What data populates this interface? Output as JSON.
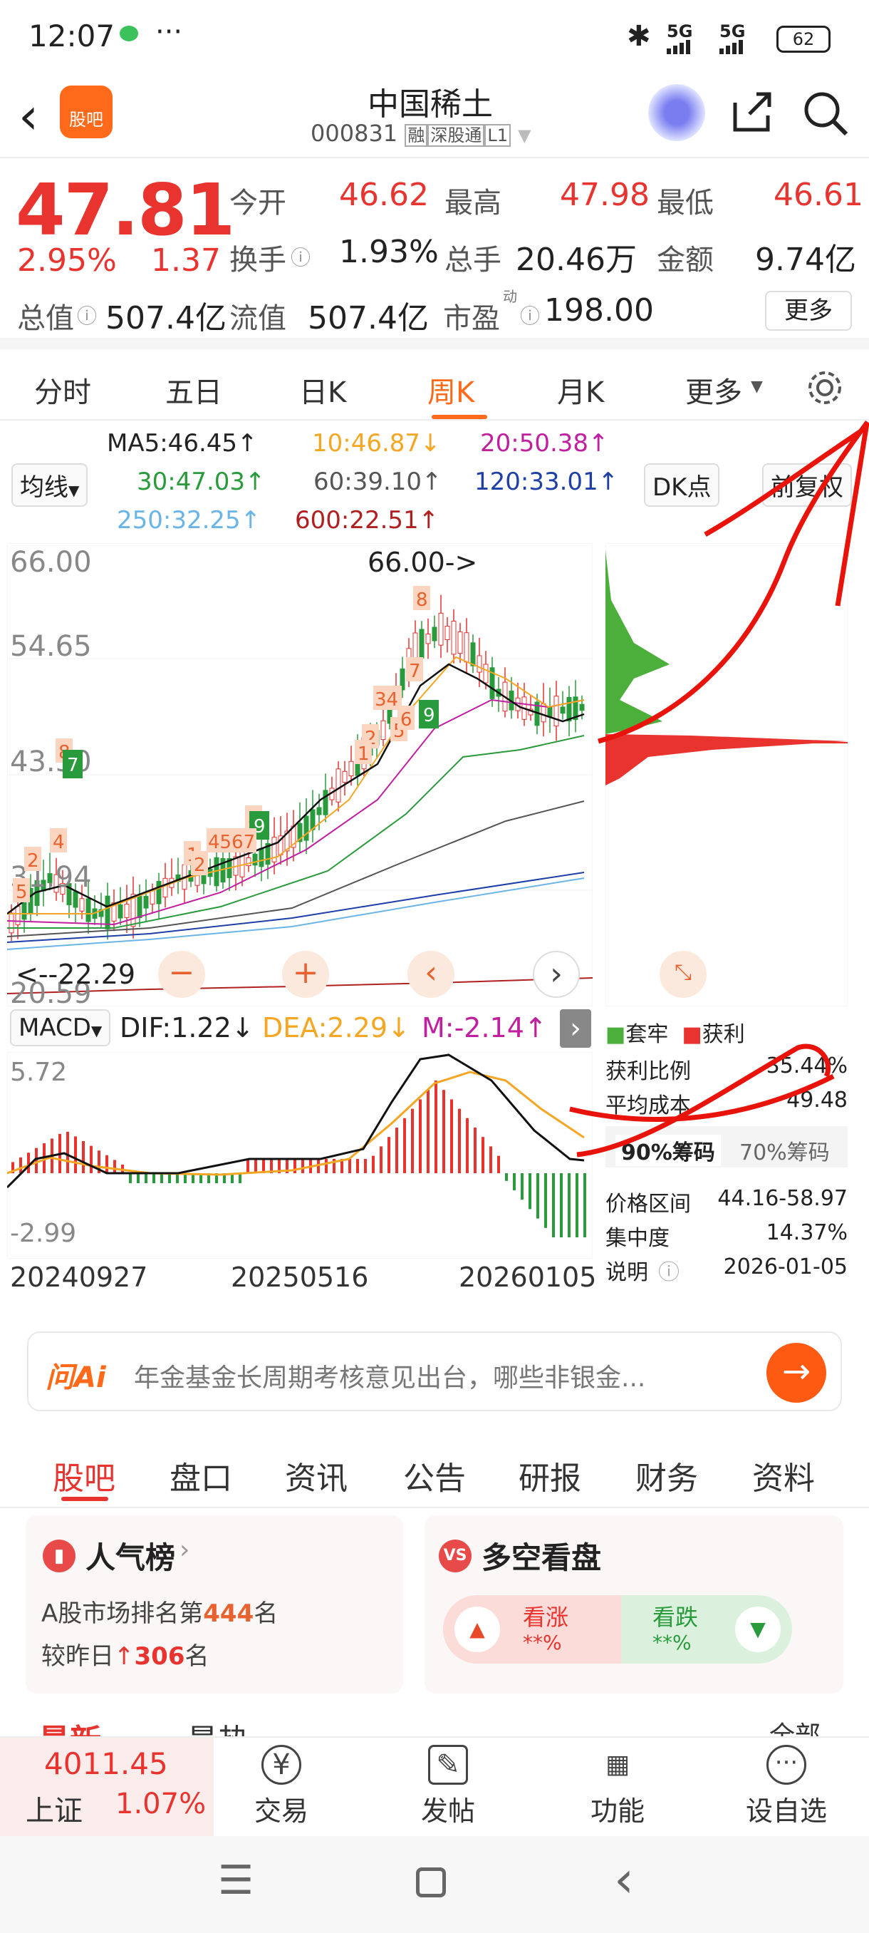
{
  "status": {
    "time": "12:07",
    "dots": "···",
    "net1": "5G",
    "net2": "5G",
    "battery": "62"
  },
  "header": {
    "logo": "股吧",
    "title": "中国稀土",
    "code": "000831",
    "tags": [
      "融",
      "深股通",
      "L1"
    ]
  },
  "quote": {
    "price": "47.81",
    "pct": "2.95%",
    "chg": "1.37",
    "open_l": "今开",
    "open_v": "46.62",
    "high_l": "最高",
    "high_v": "47.98",
    "low_l": "最低",
    "low_v": "46.61",
    "turn_l": "换手",
    "turn_v": "1.93%",
    "vol_l": "总手",
    "vol_v": "20.46万",
    "amt_l": "金额",
    "amt_v": "9.74亿",
    "mcap_l": "总值",
    "mcap_v": "507.4亿",
    "float_l": "流值",
    "float_v": "507.4亿",
    "pe_l": "市盈",
    "pe_sup": "动",
    "pe_v": "198.00",
    "more": "更多"
  },
  "period_tabs": [
    "分时",
    "五日",
    "日K",
    "周K",
    "月K",
    "更多"
  ],
  "ma": {
    "ma5": "MA5:46.45↑",
    "ma10": "10:46.87↓",
    "ma20": "20:50.38↑",
    "ma30": "30:47.03↑",
    "ma60": "60:39.10↑",
    "ma120": "120:33.01↑",
    "ma250": "250:32.25↑",
    "ma600": "600:22.51↑",
    "selector": "均线",
    "dk": "DK点",
    "fq": "前复权"
  },
  "kchart": {
    "y_top": "66.00",
    "y_mid1": "54.65",
    "y_mid2": "43.30",
    "y_mid3": "31.94",
    "y_bot": "20.59",
    "max_label": "66.00->",
    "min_label": "<--22.29",
    "marks": [
      "8",
      "7",
      "34",
      "5",
      "6",
      "2",
      "1",
      "9",
      "8",
      "9",
      "4567",
      "1",
      "2",
      "8",
      "7",
      "4",
      "2",
      "5",
      "6"
    ]
  },
  "macd": {
    "label": "MACD",
    "dif": "DIF:1.22↓",
    "dea": "DEA:2.29↓",
    "m": "M:-2.14↑",
    "y_top": "5.72",
    "y_bot": "-2.99",
    "dates": [
      "20240927",
      "20250516",
      "20260105"
    ]
  },
  "chips": {
    "legend_a": "套牢",
    "legend_b": "获利",
    "rows": [
      {
        "l": "获利比例",
        "v": "35.44%"
      },
      {
        "l": "平均成本",
        "v": "49.48"
      }
    ],
    "tab90": "90%筹码",
    "tab70": "70%筹码",
    "rows2": [
      {
        "l": "价格区间",
        "v": "44.16-58.97"
      },
      {
        "l": "集中度",
        "v": "14.37%"
      },
      {
        "l": "说明",
        "v": "2026-01-05"
      }
    ]
  },
  "ai": {
    "logo": "问Ai",
    "text": "年金基金长周期考核意见出台，哪些非银金..."
  },
  "bottom_tabs": [
    "股吧",
    "盘口",
    "资讯",
    "公告",
    "研报",
    "财务",
    "资料"
  ],
  "popular": {
    "title": "人气榜",
    "line1a": "A股市场排名第",
    "rank": "444",
    "line1b": "名",
    "line2a": "较昨日",
    "delta": "306",
    "line2b": "名"
  },
  "longshort": {
    "title": "多空看盘",
    "up": "看涨",
    "up_v": "**%",
    "down": "看跌",
    "down_v": "**%"
  },
  "section_peek": [
    "最新",
    "最热",
    "全部"
  ],
  "bottombar": {
    "index_v": "4011.45",
    "index_n": "上证",
    "index_p": "1.07%",
    "items": [
      "交易",
      "发帖",
      "功能",
      "设自选"
    ]
  },
  "colors": {
    "red": "#e8332f",
    "green": "#2a9b3c",
    "orange": "#ff6a1a"
  }
}
